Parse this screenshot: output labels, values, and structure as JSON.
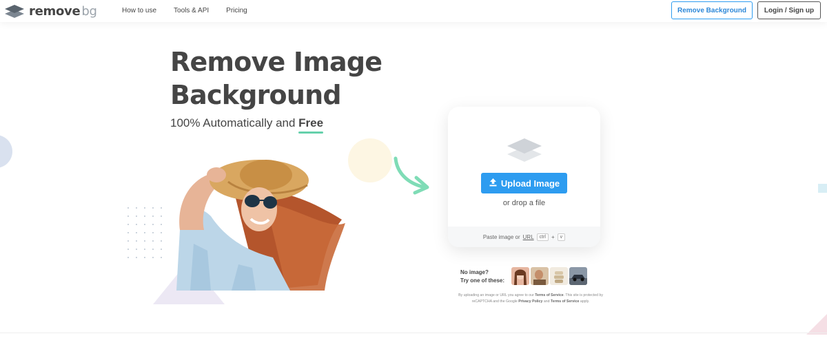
{
  "header": {
    "logo_main": "remove",
    "logo_bg": "bg",
    "nav": [
      "How to use",
      "Tools & API",
      "Pricing"
    ],
    "remove_bg_button": "Remove Background",
    "login_button": "Login / Sign up"
  },
  "hero": {
    "title_line1": "Remove Image",
    "title_line2": "Background",
    "subtitle_prefix": "100% Automatically and ",
    "subtitle_free": "Free"
  },
  "upload": {
    "button_label": "Upload Image",
    "drop_text": "or drop a file",
    "paste_prefix": "Paste image or ",
    "paste_url": "URL",
    "key_ctrl": "ctrl",
    "key_plus": "+",
    "key_v": "v"
  },
  "samples": {
    "line1": "No image?",
    "line2": "Try one of these:"
  },
  "terms": {
    "t1": "By uploading an image or URL you agree to our ",
    "tos": "Terms of Service",
    "t2": ". This site is protected by reCAPTCHA and the Google ",
    "privacy": "Privacy Policy",
    "t3": " and ",
    "tos2": "Terms of Service",
    "t4": " apply."
  },
  "colors": {
    "accent": "#2d9cf0",
    "text": "#454545",
    "highlight": "#65d0ab"
  }
}
